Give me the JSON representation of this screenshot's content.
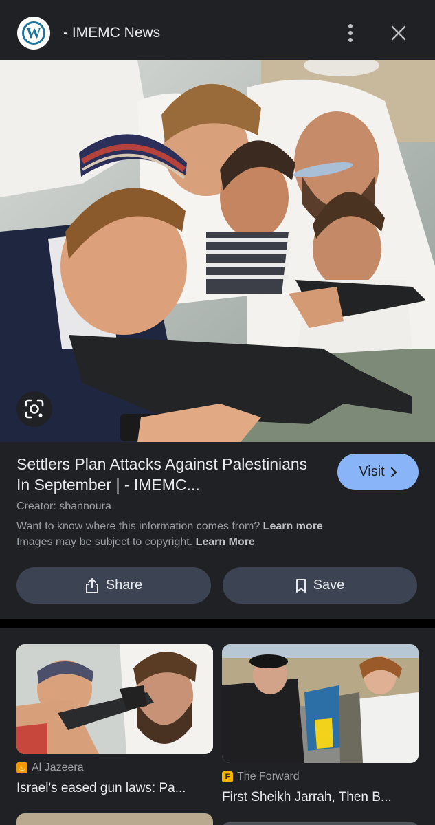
{
  "header": {
    "site_title": "- IMEMC News",
    "logo_icon": "wordpress-logo",
    "logo_glyph": "W",
    "more_icon": "more-vert-icon",
    "close_icon": "close-icon"
  },
  "detail": {
    "title": "Settlers Plan Attacks Against Palestinians In September | - IMEMC...",
    "visit_label": "Visit",
    "creator": "Creator: sbannoura",
    "info_text": "Want to know where this information comes from?",
    "info_link": "Learn more",
    "copyright_text": "Images may be subject to copyright.",
    "copyright_link": "Learn More",
    "share_label": "Share",
    "save_label": "Save",
    "accent_color": "#8ab4f8"
  },
  "related": [
    {
      "source": "Al Jazeera",
      "source_icon_color": "#f29900",
      "source_glyph": "♨",
      "title": "Israel's eased gun laws: Pa..."
    },
    {
      "source": "The Forward",
      "source_icon_color": "#f2b600",
      "source_glyph": "F",
      "title": "First Sheikh Jarrah, Then B..."
    }
  ]
}
